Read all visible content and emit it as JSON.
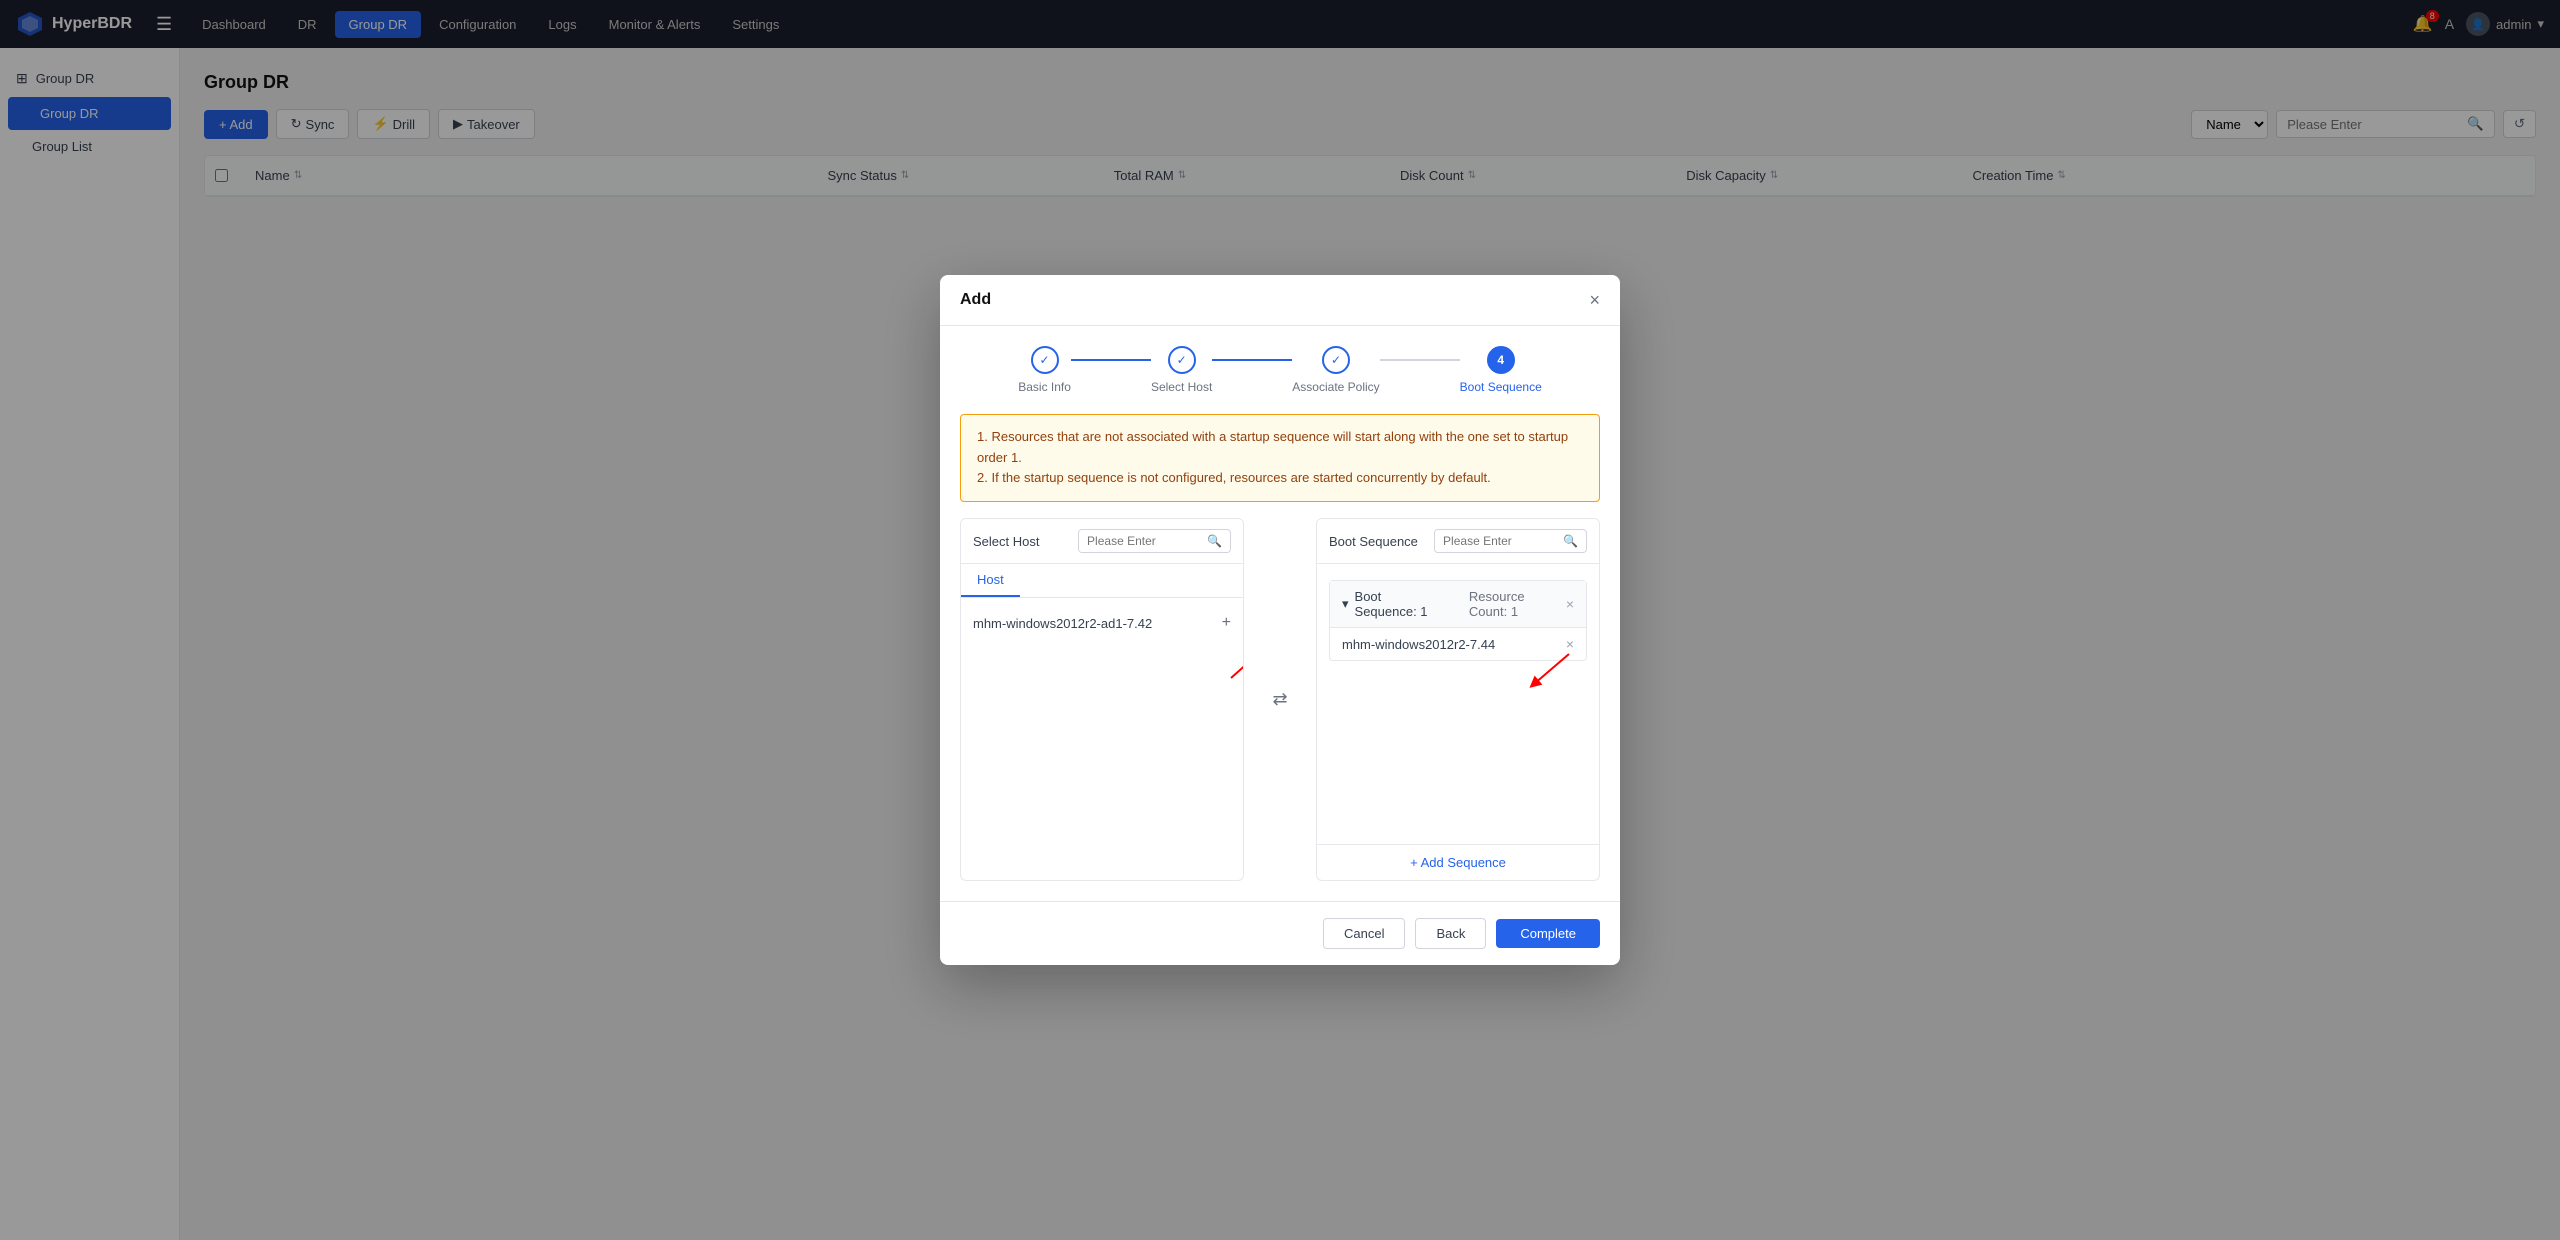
{
  "app": {
    "logo_text": "HyperBDR",
    "nav_items": [
      {
        "label": "Dashboard",
        "active": false
      },
      {
        "label": "DR",
        "active": false
      },
      {
        "label": "Group DR",
        "active": true
      },
      {
        "label": "Configuration",
        "active": false
      },
      {
        "label": "Logs",
        "active": false
      },
      {
        "label": "Monitor & Alerts",
        "active": false
      },
      {
        "label": "Settings",
        "active": false
      }
    ],
    "notif_count": "8",
    "admin_label": "admin"
  },
  "sidebar": {
    "section_label": "Group DR",
    "items": [
      {
        "label": "Group DR",
        "active": true
      },
      {
        "label": "Group List",
        "active": false
      }
    ]
  },
  "page": {
    "title": "Group DR"
  },
  "toolbar": {
    "add_label": "+ Add",
    "sync_label": "Sync",
    "drill_label": "Drill",
    "takeover_label": "Takeover",
    "search_placeholder": "Please Enter",
    "search_select_label": "Name"
  },
  "table": {
    "columns": [
      {
        "label": "Name",
        "sortable": true
      },
      {
        "label": "Sync Status",
        "sortable": true
      },
      {
        "label": "Total RAM",
        "sortable": true
      },
      {
        "label": "Disk Count",
        "sortable": true
      },
      {
        "label": "Disk Capacity",
        "sortable": true
      },
      {
        "label": "Creation Time",
        "sortable": true
      }
    ]
  },
  "modal": {
    "title": "Add",
    "close_label": "×",
    "steps": [
      {
        "label": "Basic Info",
        "state": "done"
      },
      {
        "label": "Select Host",
        "state": "done"
      },
      {
        "label": "Associate Policy",
        "state": "done"
      },
      {
        "label": "Boot Sequence",
        "state": "active",
        "number": "4"
      }
    ],
    "warning_lines": [
      "1. Resources that are not associated with a startup sequence will start along with the one set to startup order 1.",
      "2. If the startup sequence is not configured, resources are started concurrently by default."
    ],
    "left_panel": {
      "title": "Select Host",
      "search_placeholder": "Please Enter",
      "tab_host": "Host",
      "host_item": "mhm-windows2012r2-ad1-7.42"
    },
    "right_panel": {
      "title": "Boot Sequence",
      "search_placeholder": "Please Enter",
      "boot_seq_label": "Boot Sequence: 1",
      "resource_count_label": "Resource Count: 1",
      "boot_entry": "mhm-windows2012r2-7.44",
      "add_seq_label": "+ Add Sequence"
    },
    "footer": {
      "cancel_label": "Cancel",
      "back_label": "Back",
      "complete_label": "Complete"
    }
  }
}
